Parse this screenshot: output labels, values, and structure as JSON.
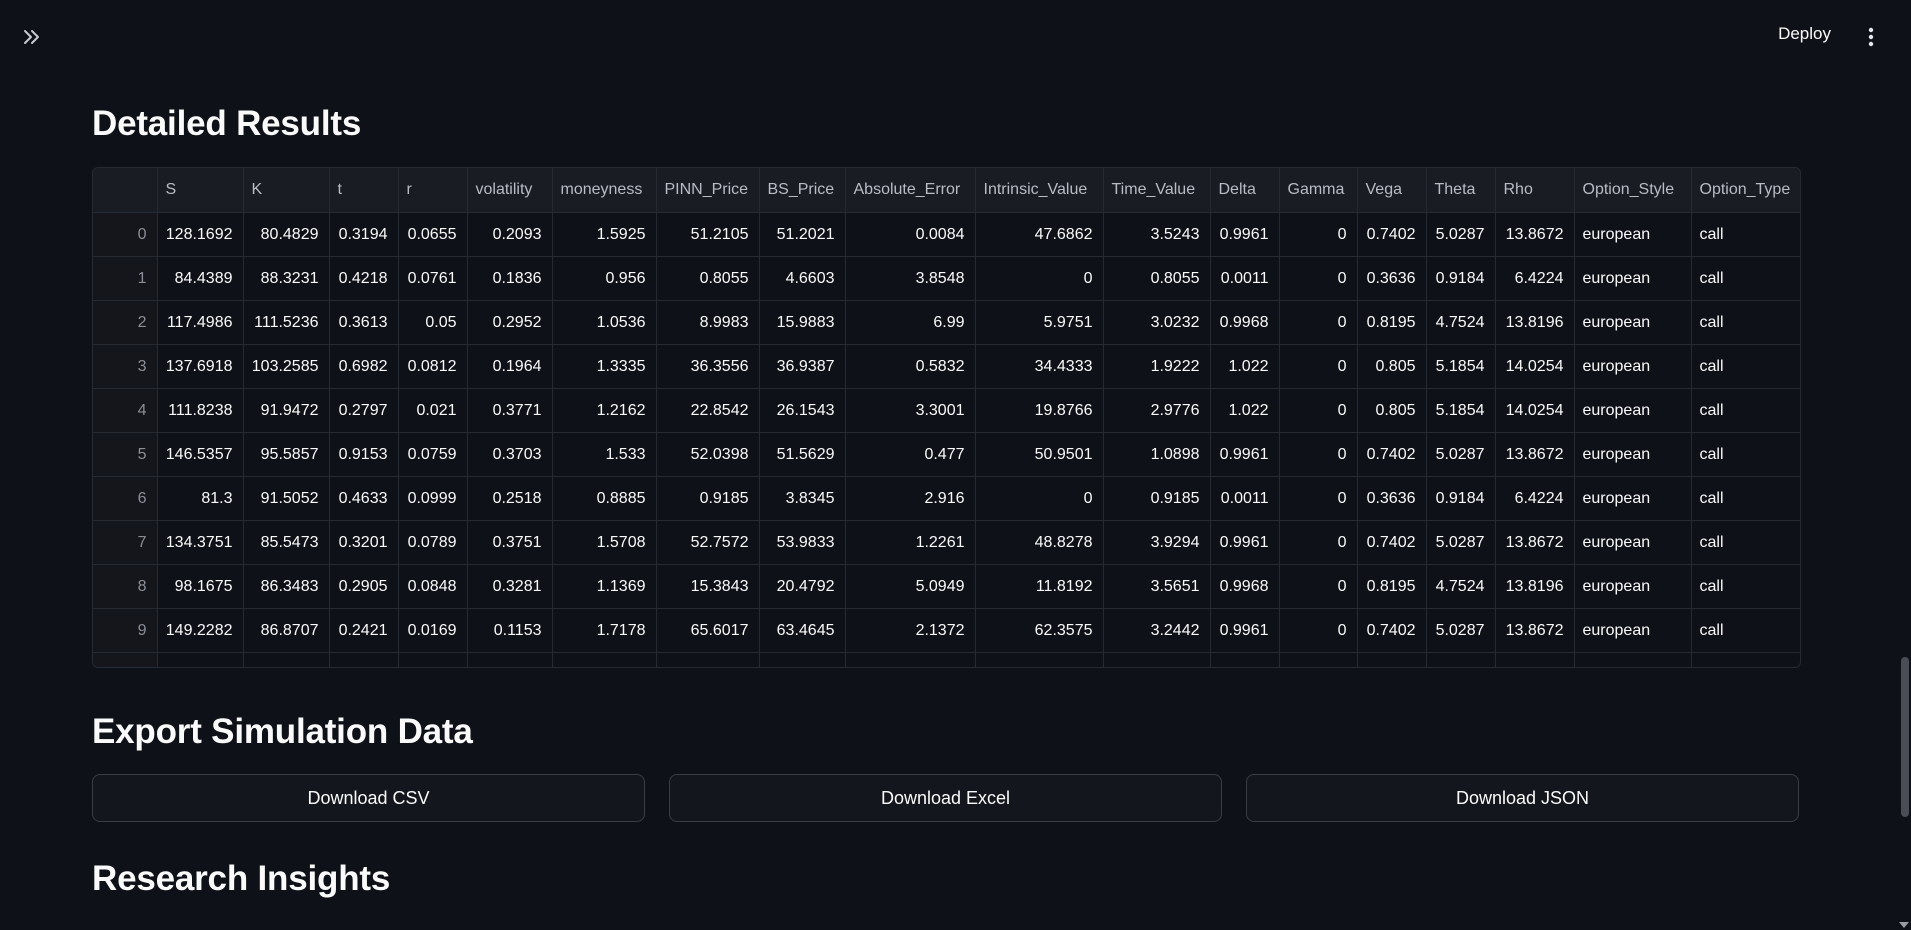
{
  "header": {
    "expand_icon": "double-chevron-right-icon",
    "deploy_label": "Deploy",
    "menu_icon": "vertical-dots-icon"
  },
  "sections": {
    "results_title": "Detailed Results",
    "export_title": "Export Simulation Data",
    "insights_title": "Research Insights"
  },
  "table": {
    "columns": [
      "",
      "S",
      "K",
      "t",
      "r",
      "volatility",
      "moneyness",
      "PINN_Price",
      "BS_Price",
      "Absolute_Error",
      "Intrinsic_Value",
      "Time_Value",
      "Delta",
      "Gamma",
      "Vega",
      "Theta",
      "Rho",
      "Option_Style",
      "Option_Type"
    ],
    "rows": [
      [
        "0",
        "128.1692",
        "80.4829",
        "0.3194",
        "0.0655",
        "0.2093",
        "1.5925",
        "51.2105",
        "51.2021",
        "0.0084",
        "47.6862",
        "3.5243",
        "0.9961",
        "0",
        "0.7402",
        "5.0287",
        "13.8672",
        "european",
        "call"
      ],
      [
        "1",
        "84.4389",
        "88.3231",
        "0.4218",
        "0.0761",
        "0.1836",
        "0.956",
        "0.8055",
        "4.6603",
        "3.8548",
        "0",
        "0.8055",
        "0.0011",
        "0",
        "0.3636",
        "0.9184",
        "6.4224",
        "european",
        "call"
      ],
      [
        "2",
        "117.4986",
        "111.5236",
        "0.3613",
        "0.05",
        "0.2952",
        "1.0536",
        "8.9983",
        "15.9883",
        "6.99",
        "5.9751",
        "3.0232",
        "0.9968",
        "0",
        "0.8195",
        "4.7524",
        "13.8196",
        "european",
        "call"
      ],
      [
        "3",
        "137.6918",
        "103.2585",
        "0.6982",
        "0.0812",
        "0.1964",
        "1.3335",
        "36.3556",
        "36.9387",
        "0.5832",
        "34.4333",
        "1.9222",
        "1.022",
        "0",
        "0.805",
        "5.1854",
        "14.0254",
        "european",
        "call"
      ],
      [
        "4",
        "111.8238",
        "91.9472",
        "0.2797",
        "0.021",
        "0.3771",
        "1.2162",
        "22.8542",
        "26.1543",
        "3.3001",
        "19.8766",
        "2.9776",
        "1.022",
        "0",
        "0.805",
        "5.1854",
        "14.0254",
        "european",
        "call"
      ],
      [
        "5",
        "146.5357",
        "95.5857",
        "0.9153",
        "0.0759",
        "0.3703",
        "1.533",
        "52.0398",
        "51.5629",
        "0.477",
        "50.9501",
        "1.0898",
        "0.9961",
        "0",
        "0.7402",
        "5.0287",
        "13.8672",
        "european",
        "call"
      ],
      [
        "6",
        "81.3",
        "91.5052",
        "0.4633",
        "0.0999",
        "0.2518",
        "0.8885",
        "0.9185",
        "3.8345",
        "2.916",
        "0",
        "0.9185",
        "0.0011",
        "0",
        "0.3636",
        "0.9184",
        "6.4224",
        "european",
        "call"
      ],
      [
        "7",
        "134.3751",
        "85.5473",
        "0.3201",
        "0.0789",
        "0.3751",
        "1.5708",
        "52.7572",
        "53.9833",
        "1.2261",
        "48.8278",
        "3.9294",
        "0.9961",
        "0",
        "0.7402",
        "5.0287",
        "13.8672",
        "european",
        "call"
      ],
      [
        "8",
        "98.1675",
        "86.3483",
        "0.2905",
        "0.0848",
        "0.3281",
        "1.1369",
        "15.3843",
        "20.4792",
        "5.0949",
        "11.8192",
        "3.5651",
        "0.9968",
        "0",
        "0.8195",
        "4.7524",
        "13.8196",
        "european",
        "call"
      ],
      [
        "9",
        "149.2282",
        "86.8707",
        "0.2421",
        "0.0169",
        "0.1153",
        "1.7178",
        "65.6017",
        "63.4645",
        "2.1372",
        "62.3575",
        "3.2442",
        "0.9961",
        "0",
        "0.7402",
        "5.0287",
        "13.8672",
        "european",
        "call"
      ]
    ]
  },
  "export": {
    "csv_label": "Download CSV",
    "excel_label": "Download Excel",
    "json_label": "Download JSON"
  }
}
